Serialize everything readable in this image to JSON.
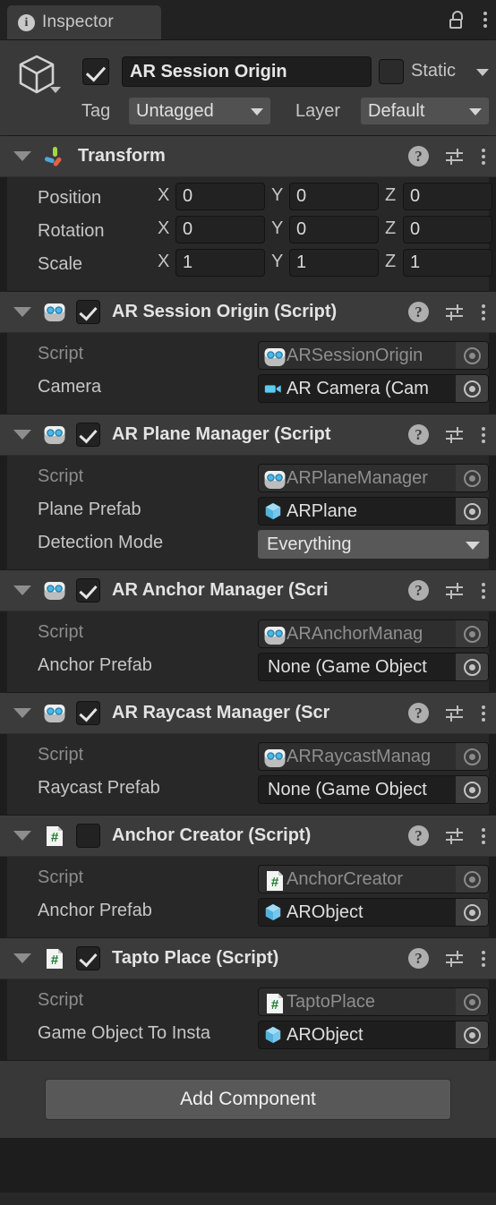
{
  "window": {
    "tab_label": "Inspector",
    "tab_icon": "info-icon",
    "lock_icon": "lock-open-icon",
    "menu_icon": "kebab-menu-icon"
  },
  "game_object": {
    "icon": "cube-icon",
    "enabled": true,
    "name": "AR Session Origin",
    "static_label": "Static",
    "static_checked": false,
    "tag_label": "Tag",
    "tag_value": "Untagged",
    "layer_label": "Layer",
    "layer_value": "Default"
  },
  "components": [
    {
      "id": "transform",
      "title": "Transform",
      "icon": "transform-gizmo-icon",
      "has_checkbox": false,
      "expanded": true,
      "rows": [
        {
          "type": "vector3",
          "label": "Position",
          "axes": [
            "X",
            "Y",
            "Z"
          ],
          "values": [
            "0",
            "0",
            "0"
          ]
        },
        {
          "type": "vector3",
          "label": "Rotation",
          "axes": [
            "X",
            "Y",
            "Z"
          ],
          "values": [
            "0",
            "0",
            "0"
          ]
        },
        {
          "type": "vector3",
          "label": "Scale",
          "axes": [
            "X",
            "Y",
            "Z"
          ],
          "values": [
            "1",
            "1",
            "1"
          ]
        }
      ]
    },
    {
      "id": "ar-session-origin",
      "title": "AR Session Origin (Script)",
      "icon": "ar-script-icon",
      "has_checkbox": true,
      "checked": true,
      "expanded": true,
      "rows": [
        {
          "type": "object",
          "label": "Script",
          "dim": true,
          "icon": "ar-script-icon",
          "value": "ARSessionOrigin"
        },
        {
          "type": "object",
          "label": "Camera",
          "dim": false,
          "icon": "camera-icon",
          "value": "AR Camera (Cam"
        }
      ]
    },
    {
      "id": "ar-plane-manager",
      "title": "AR Plane Manager (Script",
      "icon": "ar-script-icon",
      "has_checkbox": true,
      "checked": true,
      "expanded": true,
      "rows": [
        {
          "type": "object",
          "label": "Script",
          "dim": true,
          "icon": "ar-script-icon",
          "value": "ARPlaneManager"
        },
        {
          "type": "object",
          "label": "Plane Prefab",
          "dim": false,
          "icon": "prefab-cube-icon",
          "value": "ARPlane"
        },
        {
          "type": "enum",
          "label": "Detection Mode",
          "value": "Everything"
        }
      ]
    },
    {
      "id": "ar-anchor-manager",
      "title": "AR Anchor Manager (Scri",
      "icon": "ar-script-icon",
      "has_checkbox": true,
      "checked": true,
      "expanded": true,
      "rows": [
        {
          "type": "object",
          "label": "Script",
          "dim": true,
          "icon": "ar-script-icon",
          "value": "ARAnchorManag"
        },
        {
          "type": "object",
          "label": "Anchor Prefab",
          "dim": false,
          "icon": "none",
          "value": "None (Game Object"
        }
      ]
    },
    {
      "id": "ar-raycast-manager",
      "title": "AR Raycast Manager (Scr",
      "icon": "ar-script-icon",
      "has_checkbox": true,
      "checked": true,
      "expanded": true,
      "rows": [
        {
          "type": "object",
          "label": "Script",
          "dim": true,
          "icon": "ar-script-icon",
          "value": "ARRaycastManag"
        },
        {
          "type": "object",
          "label": "Raycast Prefab",
          "dim": false,
          "icon": "none",
          "value": "None (Game Object"
        }
      ]
    },
    {
      "id": "anchor-creator",
      "title": "Anchor Creator (Script)",
      "icon": "csharp-script-icon",
      "has_checkbox": true,
      "checked": false,
      "expanded": true,
      "rows": [
        {
          "type": "object",
          "label": "Script",
          "dim": true,
          "icon": "csharp-script-icon",
          "value": "AnchorCreator"
        },
        {
          "type": "object",
          "label": "Anchor Prefab",
          "dim": false,
          "icon": "prefab-cube-icon",
          "value": "ARObject"
        }
      ]
    },
    {
      "id": "tapto-place",
      "title": "Tapto Place (Script)",
      "icon": "csharp-script-icon",
      "has_checkbox": true,
      "checked": true,
      "expanded": true,
      "rows": [
        {
          "type": "object",
          "label": "Script",
          "dim": true,
          "icon": "csharp-script-icon",
          "value": "TaptoPlace"
        },
        {
          "type": "object",
          "label": "Game Object To Insta",
          "dim": false,
          "icon": "prefab-cube-icon",
          "value": "ARObject"
        }
      ]
    }
  ],
  "component_header_icons": {
    "help": "?",
    "preset": "preset-sliders-icon",
    "menu": "kebab-menu-icon"
  },
  "footer": {
    "add_component_label": "Add Component"
  },
  "colors": {
    "window_bg": "#1d1d1d",
    "panel_bg": "#282828",
    "header_bg": "#3b3b3b",
    "field_bg": "#1e1e1e",
    "dropdown_bg": "#585858",
    "text": "#c6c6c6",
    "text_dim": "#8c8c8c",
    "accent_blue": "#4ec3f0",
    "accent_green": "#2e8b30"
  }
}
